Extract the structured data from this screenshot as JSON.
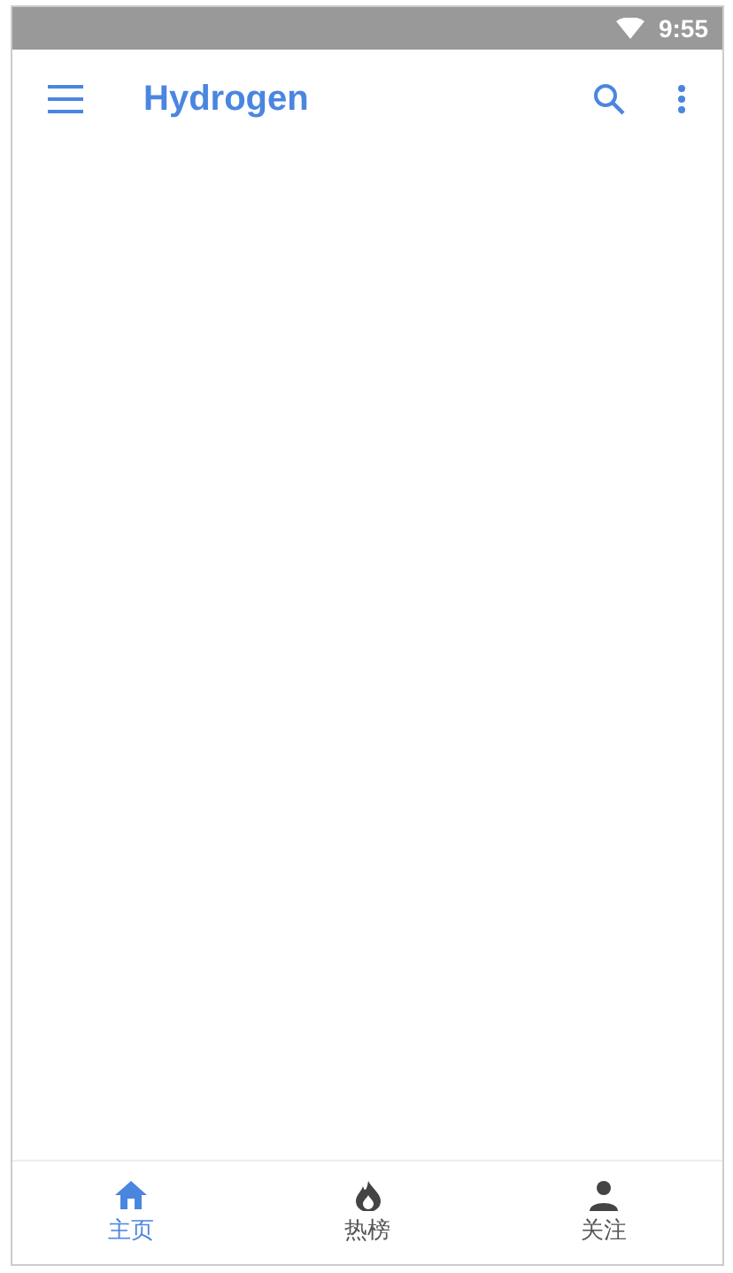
{
  "status_bar": {
    "time": "9:55"
  },
  "app_bar": {
    "title": "Hydrogen"
  },
  "bottom_nav": [
    {
      "kind": "home",
      "label": "主页",
      "selected": true
    },
    {
      "kind": "hot",
      "label": "热榜",
      "selected": false
    },
    {
      "kind": "follow",
      "label": "关注",
      "selected": false
    }
  ]
}
